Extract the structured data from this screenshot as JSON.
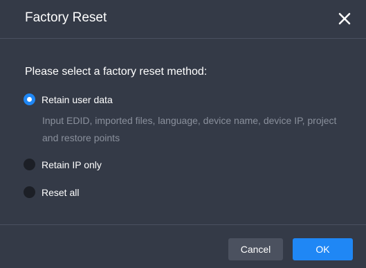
{
  "dialog": {
    "title": "Factory Reset",
    "close_icon": "close-icon",
    "prompt": "Please select a factory reset method:",
    "options": [
      {
        "label": "Retain user data",
        "selected": true,
        "description": "Input EDID, imported files, language, device name, device IP, project and restore points"
      },
      {
        "label": "Retain IP only",
        "selected": false
      },
      {
        "label": "Reset all",
        "selected": false
      }
    ],
    "buttons": {
      "cancel_label": "Cancel",
      "ok_label": "OK"
    }
  },
  "colors": {
    "background": "#343a47",
    "accent": "#1f87f5",
    "description_text": "#8a909c"
  }
}
